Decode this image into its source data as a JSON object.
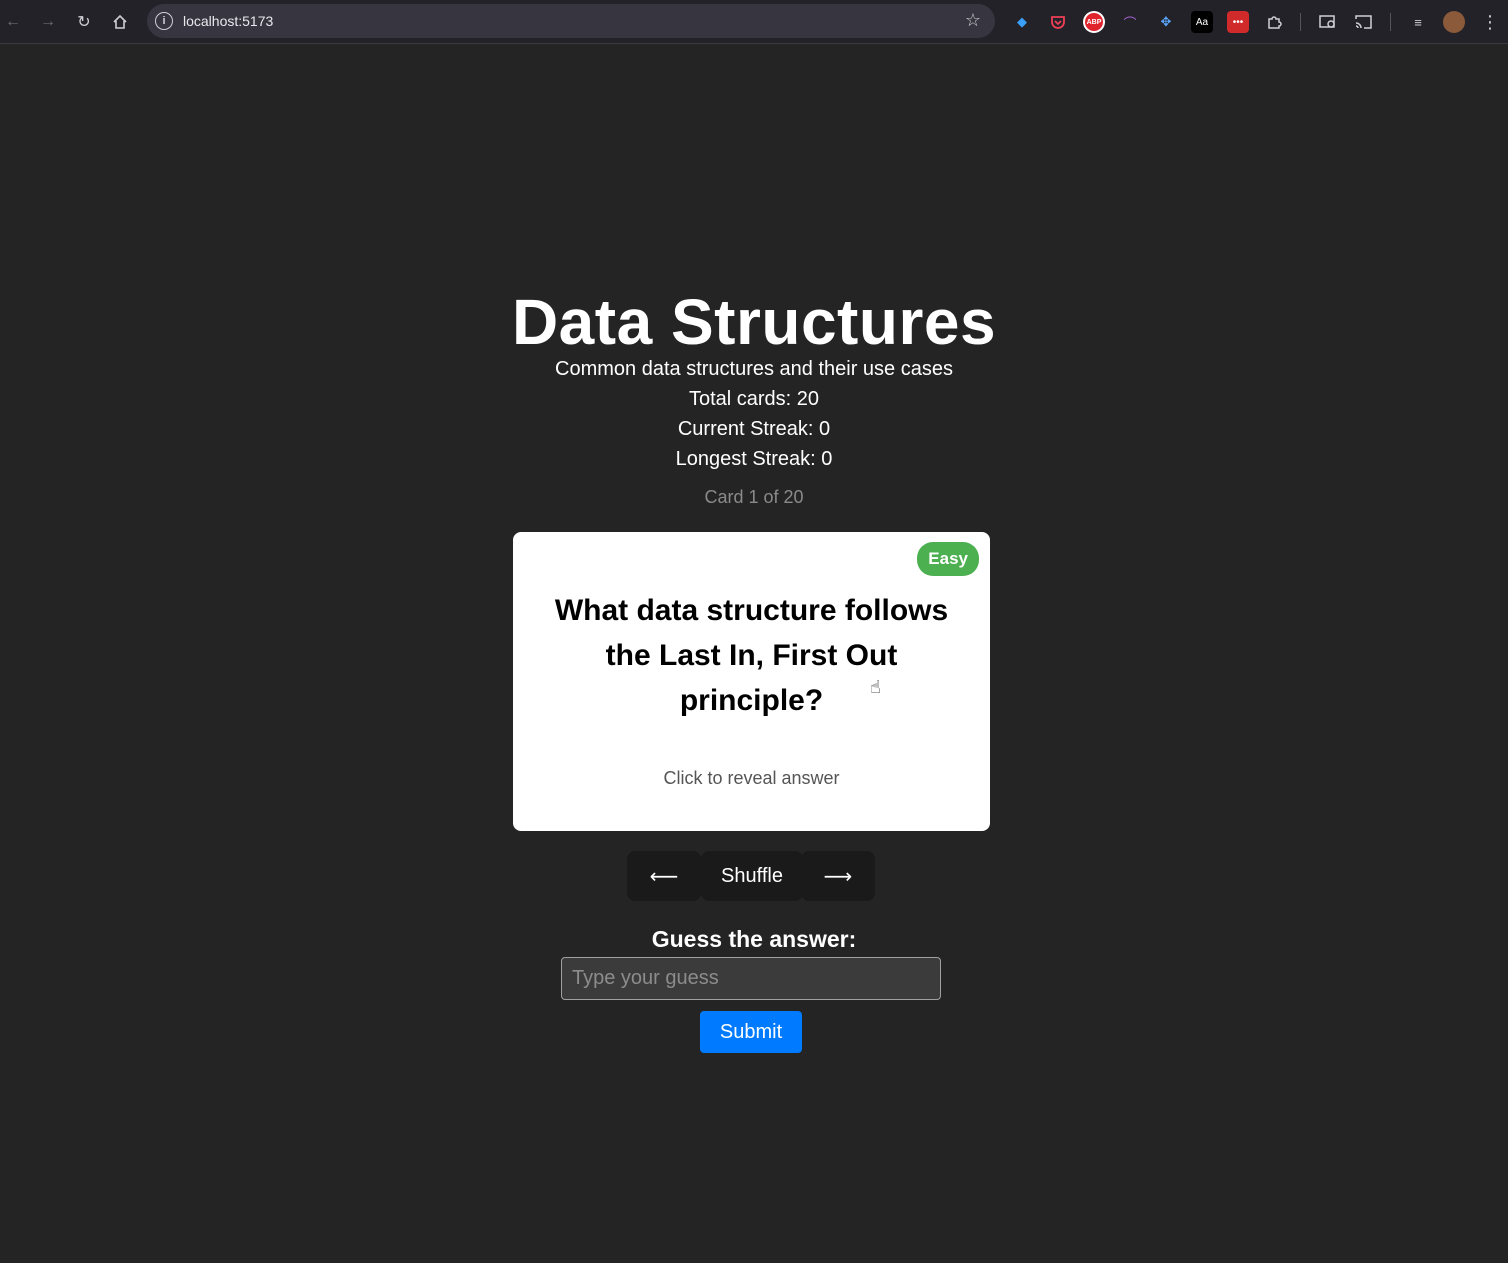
{
  "browser": {
    "url": "localhost:5173"
  },
  "deck": {
    "title": "Data Structures",
    "description": "Common data structures and their use cases",
    "total_cards": "Total cards: 20",
    "current_streak": "Current Streak: 0",
    "longest_streak": "Longest Streak: 0",
    "card_counter": "Card 1 of 20"
  },
  "card": {
    "difficulty": "Easy",
    "difficulty_color": "#4caf50",
    "question": "What data structure follows the Last In, First Out principle?",
    "hint": "Click to reveal answer"
  },
  "controls": {
    "prev_label": "⟵",
    "shuffle_label": "Shuffle",
    "next_label": "⟶"
  },
  "guess": {
    "label": "Guess the answer:",
    "placeholder": "Type your guess",
    "value": "",
    "submit_label": "Submit",
    "submit_color": "#007bff"
  }
}
